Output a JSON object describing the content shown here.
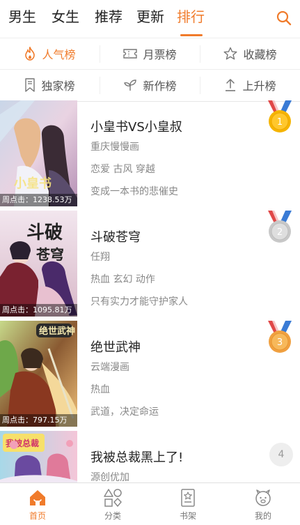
{
  "top_tabs": [
    "男生",
    "女生",
    "推荐",
    "更新",
    "排行"
  ],
  "rank_types": [
    "人气榜",
    "月票榜",
    "收藏榜",
    "独家榜",
    "新作榜",
    "上升榜"
  ],
  "items": [
    {
      "rank": "1",
      "title": "小皇书VS小皇叔",
      "author": "重庆慢慢画",
      "tags": "恋爱  古风  穿越",
      "desc": "变成一本书的悲催史",
      "clicks": "周点击：1238.53万"
    },
    {
      "rank": "2",
      "title": "斗破苍穹",
      "author": "任翔",
      "tags": "热血  玄幻  动作",
      "desc": "只有实力才能守护家人",
      "clicks": "周点击：1095.81万"
    },
    {
      "rank": "3",
      "title": "绝世武神",
      "author": "云端漫画",
      "tags": "热血",
      "desc": "武道，决定命运",
      "clicks": "周点击：797.15万"
    },
    {
      "rank": "4",
      "title": "我被总裁黑上了!",
      "author": "源创优加",
      "tags": "",
      "desc": "",
      "clicks": ""
    }
  ],
  "bottom_nav": [
    "首页",
    "分类",
    "书架",
    "我的"
  ],
  "colors": {
    "accent": "#f07b2b",
    "gold": "#f5b400",
    "silver": "#c8c8c8",
    "bronze": "#f0a040",
    "ribbon_red": "#e04848",
    "ribbon_blue": "#3a7bd5"
  }
}
